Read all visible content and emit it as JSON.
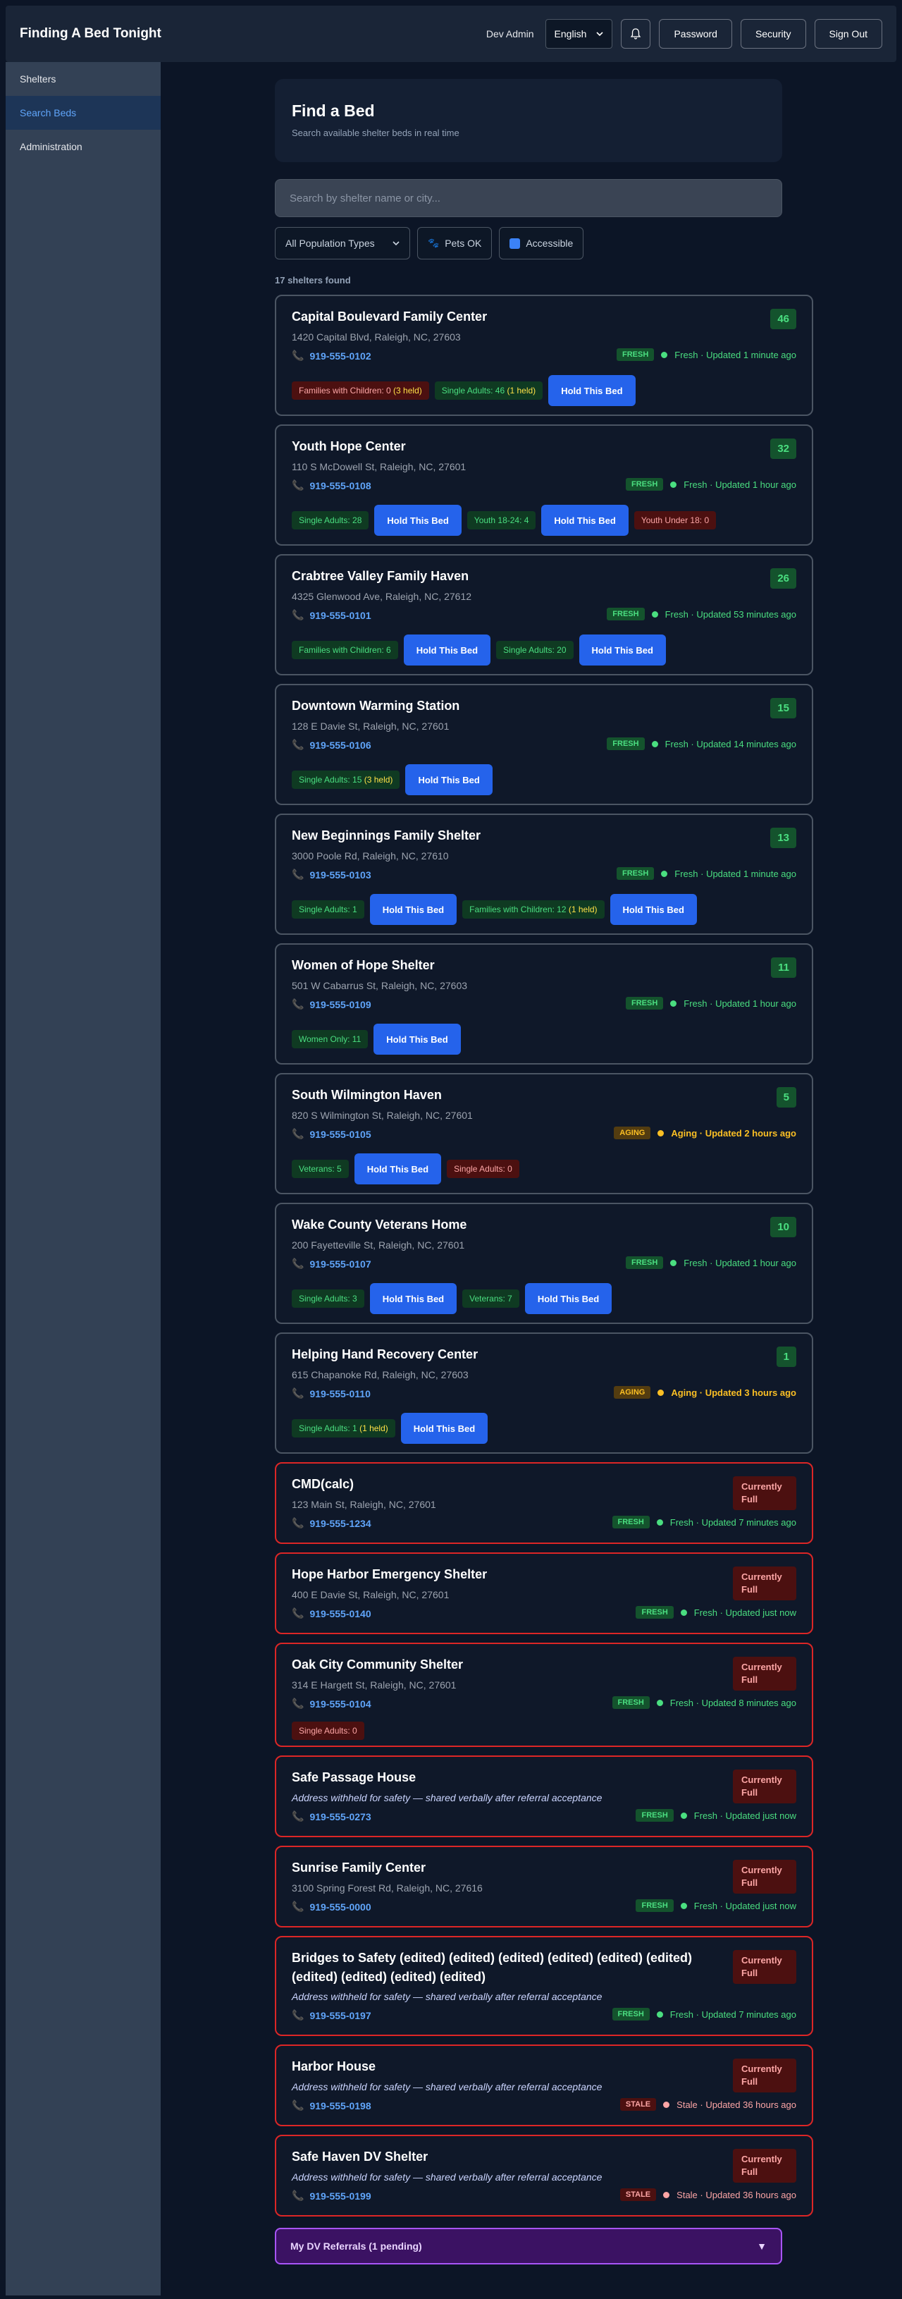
{
  "header": {
    "app_title": "Finding A Bed Tonight",
    "user_name": "Dev Admin",
    "language": "English",
    "password_label": "Password",
    "security_label": "Security",
    "signout_label": "Sign Out"
  },
  "sidebar": {
    "items": [
      {
        "label": "Shelters"
      },
      {
        "label": "Search Beds"
      },
      {
        "label": "Administration"
      }
    ]
  },
  "hero": {
    "title": "Find a Bed",
    "subtitle": "Search available shelter beds in real time"
  },
  "search": {
    "placeholder": "Search by shelter name or city..."
  },
  "filters": {
    "population": "All Population Types",
    "pets": "Pets OK",
    "accessible": "Accessible"
  },
  "results_count": "17 shelters found",
  "hold_label": "Hold This Bed",
  "full_label": "Currently Full",
  "shelters": [
    {
      "name": "Capital Boulevard Family Center",
      "address": "1420 Capital Blvd, Raleigh, NC, 27603",
      "phone": "919-555-0102",
      "count": "46",
      "tag": "FRESH",
      "status": "Fresh · Updated 1 minute ago",
      "pops": [
        {
          "text": "Families with Children: 0",
          "held": " (3 held)",
          "ok": false
        },
        {
          "text": "Single Adults: 46",
          "held": " (1 held)",
          "ok": true
        }
      ]
    },
    {
      "name": "Youth Hope Center",
      "address": "110 S McDowell St, Raleigh, NC, 27601",
      "phone": "919-555-0108",
      "count": "32",
      "tag": "FRESH",
      "status": "Fresh · Updated 1 hour ago",
      "pops": [
        {
          "text": "Single Adults: 28",
          "ok": true
        },
        {
          "text": "Youth 18-24: 4",
          "ok": true
        },
        {
          "text": "Youth Under 18: 0",
          "ok": false
        }
      ]
    },
    {
      "name": "Crabtree Valley Family Haven",
      "address": "4325 Glenwood Ave, Raleigh, NC, 27612",
      "phone": "919-555-0101",
      "count": "26",
      "tag": "FRESH",
      "status": "Fresh · Updated 53 minutes ago",
      "pops": [
        {
          "text": "Families with Children: 6",
          "ok": true
        },
        {
          "text": "Single Adults: 20",
          "ok": true
        }
      ]
    },
    {
      "name": "Downtown Warming Station",
      "address": "128 E Davie St, Raleigh, NC, 27601",
      "phone": "919-555-0106",
      "count": "15",
      "tag": "FRESH",
      "status": "Fresh · Updated 14 minutes ago",
      "pops": [
        {
          "text": "Single Adults: 15",
          "held": " (3 held)",
          "ok": true
        }
      ]
    },
    {
      "name": "New Beginnings Family Shelter",
      "address": "3000 Poole Rd, Raleigh, NC, 27610",
      "phone": "919-555-0103",
      "count": "13",
      "tag": "FRESH",
      "status": "Fresh · Updated 1 minute ago",
      "pops": [
        {
          "text": "Single Adults: 1",
          "ok": true
        },
        {
          "text": "Families with Children: 12",
          "held": " (1 held)",
          "ok": true
        }
      ]
    },
    {
      "name": "Women of Hope Shelter",
      "address": "501 W Cabarrus St, Raleigh, NC, 27603",
      "phone": "919-555-0109",
      "count": "11",
      "tag": "FRESH",
      "status": "Fresh · Updated 1 hour ago",
      "pops": [
        {
          "text": "Women Only: 11",
          "ok": true
        }
      ]
    },
    {
      "name": "South Wilmington Haven",
      "address": "820 S Wilmington St, Raleigh, NC, 27601",
      "phone": "919-555-0105",
      "count": "5",
      "tag": "AGING",
      "status": "Aging · Updated 2 hours ago",
      "pops": [
        {
          "text": "Veterans: 5",
          "ok": true
        },
        {
          "text": "Single Adults: 0",
          "ok": false
        }
      ]
    },
    {
      "name": "Wake County Veterans Home",
      "address": "200 Fayetteville St, Raleigh, NC, 27601",
      "phone": "919-555-0107",
      "count": "10",
      "tag": "FRESH",
      "status": "Fresh · Updated 1 hour ago",
      "pops": [
        {
          "text": "Single Adults: 3",
          "ok": true
        },
        {
          "text": "Veterans: 7",
          "ok": true
        }
      ]
    },
    {
      "name": "Helping Hand Recovery Center",
      "address": "615 Chapanoke Rd, Raleigh, NC, 27603",
      "phone": "919-555-0110",
      "count": "1",
      "tag": "AGING",
      "status": "Aging · Updated 3 hours ago",
      "pops": [
        {
          "text": "Single Adults: 1",
          "held": " (1 held)",
          "ok": true
        }
      ]
    },
    {
      "name": "CMD(calc)",
      "address": "123 Main St, Raleigh, NC, 27601",
      "phone": "919-555-1234",
      "tag": "FRESH",
      "status": "Fresh · Updated 7 minutes ago",
      "pops": []
    },
    {
      "name": "Hope Harbor Emergency Shelter",
      "address": "400 E Davie St, Raleigh, NC, 27601",
      "phone": "919-555-0140",
      "tag": "FRESH",
      "status": "Fresh · Updated just now",
      "pops": []
    },
    {
      "name": "Oak City Community Shelter",
      "address": "314 E Hargett St, Raleigh, NC, 27601",
      "phone": "919-555-0104",
      "tag": "FRESH",
      "status": "Fresh · Updated 8 minutes ago",
      "pops": [
        {
          "text": "Single Adults: 0",
          "ok": false
        }
      ]
    },
    {
      "name": "Safe Passage House",
      "address": "Address withheld for safety — shared verbally after referral acceptance",
      "phone": "919-555-0273",
      "tag": "FRESH",
      "status": "Fresh · Updated just now",
      "pops": []
    },
    {
      "name": "Sunrise Family Center",
      "address": "3100 Spring Forest Rd, Raleigh, NC, 27616",
      "phone": "919-555-0000",
      "tag": "FRESH",
      "status": "Fresh · Updated just now",
      "pops": []
    },
    {
      "name": "Bridges to Safety (edited) (edited) (edited) (edited) (edited) (edited) (edited) (edited) (edited) (edited)",
      "address": "Address withheld for safety — shared verbally after referral acceptance",
      "phone": "919-555-0197",
      "tag": "FRESH",
      "status": "Fresh · Updated 7 minutes ago",
      "pops": []
    },
    {
      "name": "Harbor House",
      "address": "Address withheld for safety — shared verbally after referral acceptance",
      "phone": "919-555-0198",
      "tag": "STALE",
      "status": "Stale · Updated 36 hours ago",
      "pops": []
    },
    {
      "name": "Safe Haven DV Shelter",
      "address": "Address withheld for safety — shared verbally after referral acceptance",
      "phone": "919-555-0199",
      "tag": "STALE",
      "status": "Stale · Updated 36 hours ago",
      "pops": []
    }
  ],
  "dv_referrals": "My DV Referrals (1 pending)",
  "colors": {
    "accent": "#2563eb",
    "fresh": "#4ade80",
    "aging": "#fbbf24",
    "stale": "#fca5a5",
    "full_border": "#dc2626"
  }
}
